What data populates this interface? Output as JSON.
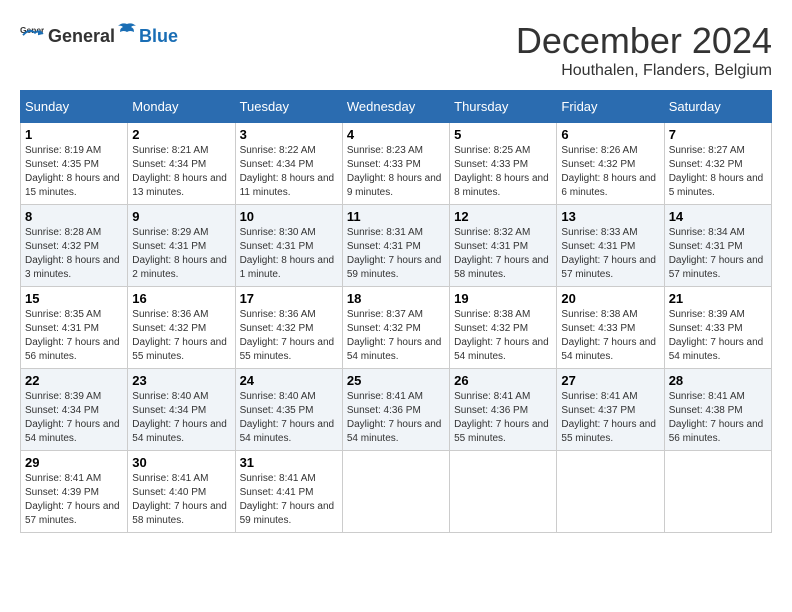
{
  "header": {
    "logo_general": "General",
    "logo_blue": "Blue",
    "month": "December 2024",
    "location": "Houthalen, Flanders, Belgium"
  },
  "weekdays": [
    "Sunday",
    "Monday",
    "Tuesday",
    "Wednesday",
    "Thursday",
    "Friday",
    "Saturday"
  ],
  "weeks": [
    [
      {
        "day": "1",
        "sunrise": "Sunrise: 8:19 AM",
        "sunset": "Sunset: 4:35 PM",
        "daylight": "Daylight: 8 hours and 15 minutes."
      },
      {
        "day": "2",
        "sunrise": "Sunrise: 8:21 AM",
        "sunset": "Sunset: 4:34 PM",
        "daylight": "Daylight: 8 hours and 13 minutes."
      },
      {
        "day": "3",
        "sunrise": "Sunrise: 8:22 AM",
        "sunset": "Sunset: 4:34 PM",
        "daylight": "Daylight: 8 hours and 11 minutes."
      },
      {
        "day": "4",
        "sunrise": "Sunrise: 8:23 AM",
        "sunset": "Sunset: 4:33 PM",
        "daylight": "Daylight: 8 hours and 9 minutes."
      },
      {
        "day": "5",
        "sunrise": "Sunrise: 8:25 AM",
        "sunset": "Sunset: 4:33 PM",
        "daylight": "Daylight: 8 hours and 8 minutes."
      },
      {
        "day": "6",
        "sunrise": "Sunrise: 8:26 AM",
        "sunset": "Sunset: 4:32 PM",
        "daylight": "Daylight: 8 hours and 6 minutes."
      },
      {
        "day": "7",
        "sunrise": "Sunrise: 8:27 AM",
        "sunset": "Sunset: 4:32 PM",
        "daylight": "Daylight: 8 hours and 5 minutes."
      }
    ],
    [
      {
        "day": "8",
        "sunrise": "Sunrise: 8:28 AM",
        "sunset": "Sunset: 4:32 PM",
        "daylight": "Daylight: 8 hours and 3 minutes."
      },
      {
        "day": "9",
        "sunrise": "Sunrise: 8:29 AM",
        "sunset": "Sunset: 4:31 PM",
        "daylight": "Daylight: 8 hours and 2 minutes."
      },
      {
        "day": "10",
        "sunrise": "Sunrise: 8:30 AM",
        "sunset": "Sunset: 4:31 PM",
        "daylight": "Daylight: 8 hours and 1 minute."
      },
      {
        "day": "11",
        "sunrise": "Sunrise: 8:31 AM",
        "sunset": "Sunset: 4:31 PM",
        "daylight": "Daylight: 7 hours and 59 minutes."
      },
      {
        "day": "12",
        "sunrise": "Sunrise: 8:32 AM",
        "sunset": "Sunset: 4:31 PM",
        "daylight": "Daylight: 7 hours and 58 minutes."
      },
      {
        "day": "13",
        "sunrise": "Sunrise: 8:33 AM",
        "sunset": "Sunset: 4:31 PM",
        "daylight": "Daylight: 7 hours and 57 minutes."
      },
      {
        "day": "14",
        "sunrise": "Sunrise: 8:34 AM",
        "sunset": "Sunset: 4:31 PM",
        "daylight": "Daylight: 7 hours and 57 minutes."
      }
    ],
    [
      {
        "day": "15",
        "sunrise": "Sunrise: 8:35 AM",
        "sunset": "Sunset: 4:31 PM",
        "daylight": "Daylight: 7 hours and 56 minutes."
      },
      {
        "day": "16",
        "sunrise": "Sunrise: 8:36 AM",
        "sunset": "Sunset: 4:32 PM",
        "daylight": "Daylight: 7 hours and 55 minutes."
      },
      {
        "day": "17",
        "sunrise": "Sunrise: 8:36 AM",
        "sunset": "Sunset: 4:32 PM",
        "daylight": "Daylight: 7 hours and 55 minutes."
      },
      {
        "day": "18",
        "sunrise": "Sunrise: 8:37 AM",
        "sunset": "Sunset: 4:32 PM",
        "daylight": "Daylight: 7 hours and 54 minutes."
      },
      {
        "day": "19",
        "sunrise": "Sunrise: 8:38 AM",
        "sunset": "Sunset: 4:32 PM",
        "daylight": "Daylight: 7 hours and 54 minutes."
      },
      {
        "day": "20",
        "sunrise": "Sunrise: 8:38 AM",
        "sunset": "Sunset: 4:33 PM",
        "daylight": "Daylight: 7 hours and 54 minutes."
      },
      {
        "day": "21",
        "sunrise": "Sunrise: 8:39 AM",
        "sunset": "Sunset: 4:33 PM",
        "daylight": "Daylight: 7 hours and 54 minutes."
      }
    ],
    [
      {
        "day": "22",
        "sunrise": "Sunrise: 8:39 AM",
        "sunset": "Sunset: 4:34 PM",
        "daylight": "Daylight: 7 hours and 54 minutes."
      },
      {
        "day": "23",
        "sunrise": "Sunrise: 8:40 AM",
        "sunset": "Sunset: 4:34 PM",
        "daylight": "Daylight: 7 hours and 54 minutes."
      },
      {
        "day": "24",
        "sunrise": "Sunrise: 8:40 AM",
        "sunset": "Sunset: 4:35 PM",
        "daylight": "Daylight: 7 hours and 54 minutes."
      },
      {
        "day": "25",
        "sunrise": "Sunrise: 8:41 AM",
        "sunset": "Sunset: 4:36 PM",
        "daylight": "Daylight: 7 hours and 54 minutes."
      },
      {
        "day": "26",
        "sunrise": "Sunrise: 8:41 AM",
        "sunset": "Sunset: 4:36 PM",
        "daylight": "Daylight: 7 hours and 55 minutes."
      },
      {
        "day": "27",
        "sunrise": "Sunrise: 8:41 AM",
        "sunset": "Sunset: 4:37 PM",
        "daylight": "Daylight: 7 hours and 55 minutes."
      },
      {
        "day": "28",
        "sunrise": "Sunrise: 8:41 AM",
        "sunset": "Sunset: 4:38 PM",
        "daylight": "Daylight: 7 hours and 56 minutes."
      }
    ],
    [
      {
        "day": "29",
        "sunrise": "Sunrise: 8:41 AM",
        "sunset": "Sunset: 4:39 PM",
        "daylight": "Daylight: 7 hours and 57 minutes."
      },
      {
        "day": "30",
        "sunrise": "Sunrise: 8:41 AM",
        "sunset": "Sunset: 4:40 PM",
        "daylight": "Daylight: 7 hours and 58 minutes."
      },
      {
        "day": "31",
        "sunrise": "Sunrise: 8:41 AM",
        "sunset": "Sunset: 4:41 PM",
        "daylight": "Daylight: 7 hours and 59 minutes."
      },
      null,
      null,
      null,
      null
    ]
  ]
}
